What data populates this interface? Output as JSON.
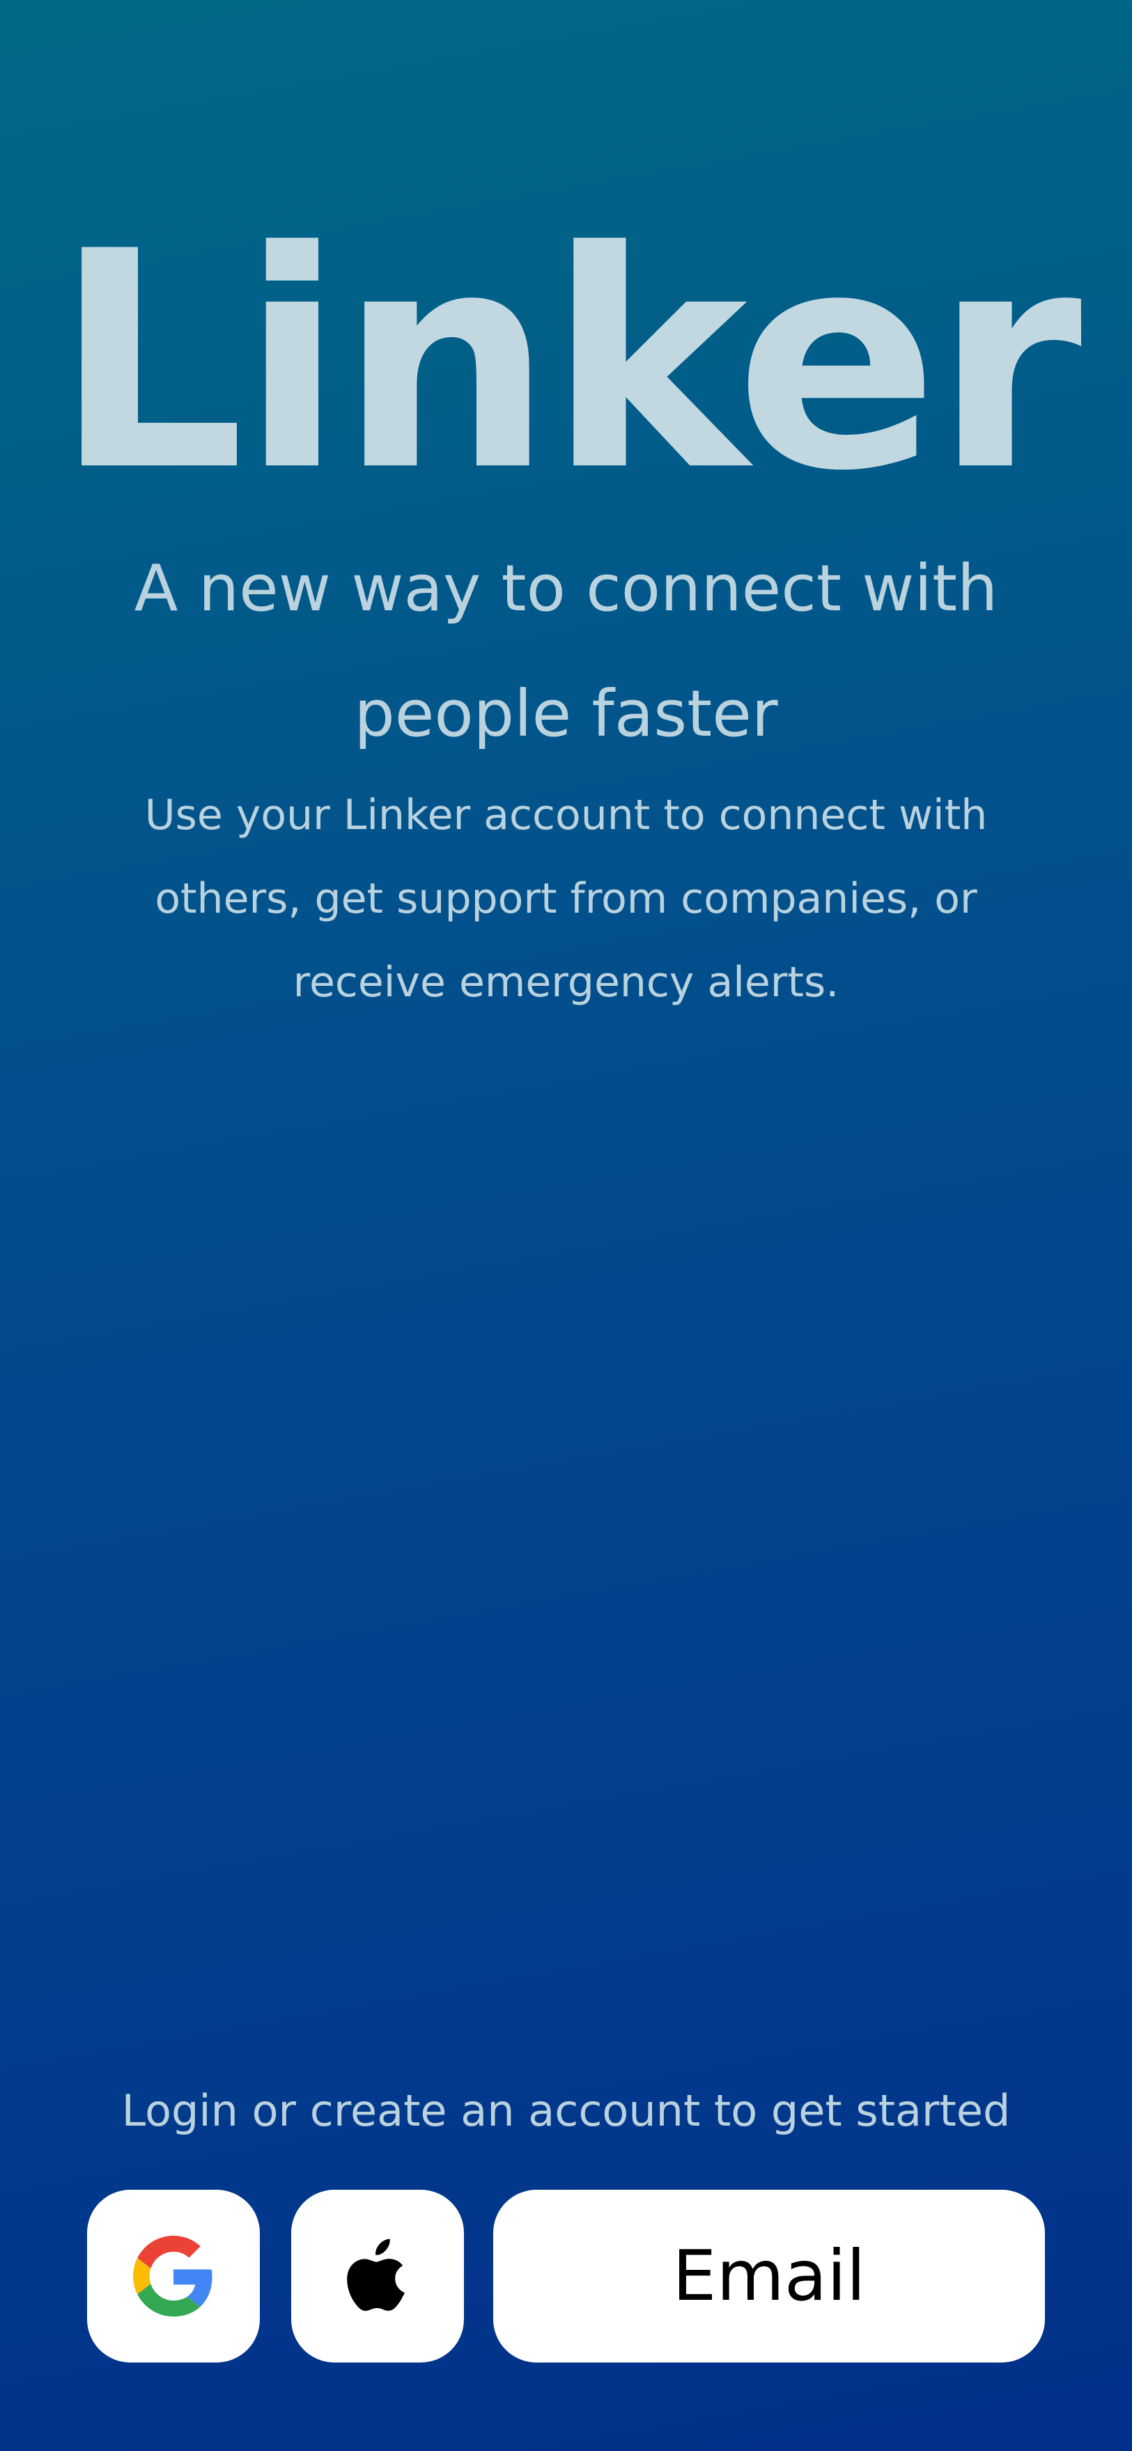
{
  "app": {
    "title": "Linker",
    "tagline": "A new way to connect with people faster",
    "description": "Use your Linker account to connect with others, get support from companies, or receive emergency alerts."
  },
  "auth": {
    "prompt": "Login or create an account to get started",
    "google_icon": "google-icon",
    "apple_icon": "apple-icon",
    "email_label": "Email"
  },
  "colors": {
    "background_top": "#006a86",
    "background_bottom": "#022f8a",
    "text": "#b9d2de",
    "button_bg": "#ffffff"
  }
}
